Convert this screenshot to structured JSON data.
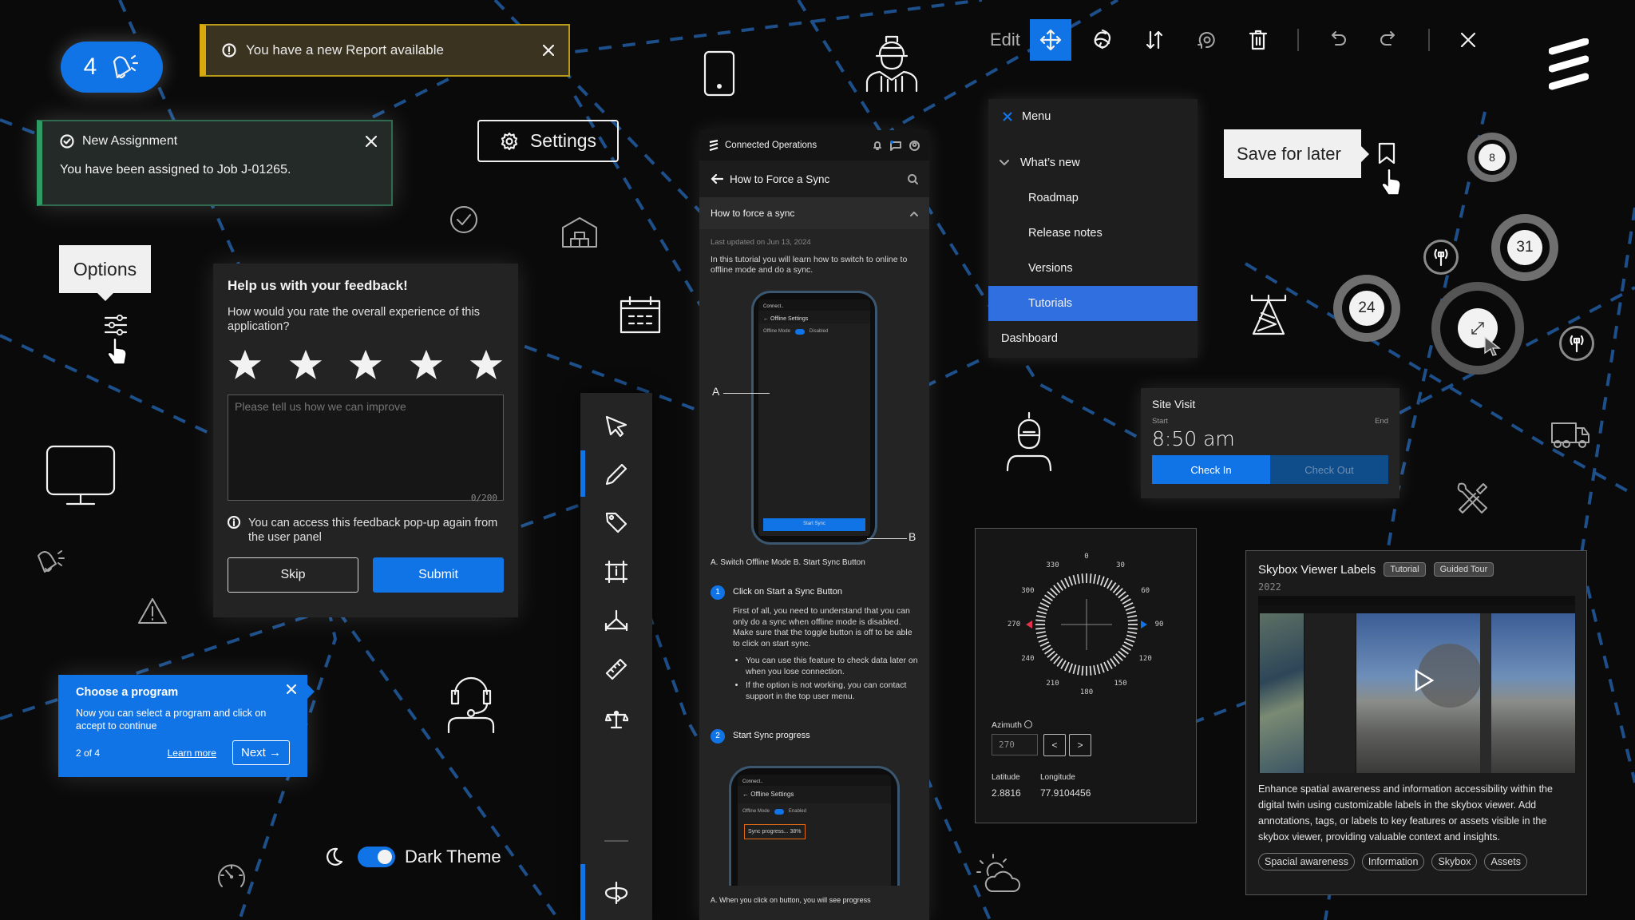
{
  "colors": {
    "accent": "#1174e6",
    "warning": "#d8a80e",
    "success": "#2d9b62",
    "menu_selected": "#2f6fe0",
    "progress_outline": "#e46a16",
    "background": "#0a0a0a"
  },
  "notification_badge": {
    "count": "4",
    "icon": "bell-ringing-icon"
  },
  "report_toast": {
    "icon": "info-circle-icon",
    "message": "You have a new Report available",
    "close_icon": "close-icon"
  },
  "assignment_toast": {
    "icon": "check-circle-icon",
    "title": "New Assignment",
    "message": "You have been assigned to Job J-01265.",
    "close_icon": "close-icon"
  },
  "settings_button": {
    "icon": "gear-icon",
    "label": "Settings"
  },
  "options_tooltip": {
    "label": "Options",
    "icon": "sliders-icon",
    "cursor": "hand-pointer-icon"
  },
  "feedback": {
    "title": "Help us with your feedback!",
    "question": "How would you rate the overall experience of this application?",
    "rating": {
      "value": 5,
      "max": 5
    },
    "textarea_placeholder": "Please tell us how we can improve",
    "textarea_value": "",
    "char_count": "0/200",
    "info_text": "You can access this feedback pop-up again from the user panel",
    "skip_label": "Skip",
    "submit_label": "Submit"
  },
  "coach_mark": {
    "title": "Choose a program",
    "body": "Now you can select a program  and click on accept to continue",
    "step": "2 of 4",
    "learn_more": "Learn more",
    "next_label": "Next →"
  },
  "theme_toggle": {
    "icon": "moon-icon",
    "label": "Dark Theme",
    "enabled": true
  },
  "tool_rail": {
    "items": [
      {
        "name": "select-pointer-icon",
        "active": false
      },
      {
        "name": "pencil-icon",
        "active": true
      },
      {
        "name": "tag-icon",
        "active": false
      },
      {
        "name": "info-frame-icon",
        "active": false
      },
      {
        "name": "measure-angle-icon",
        "active": false
      },
      {
        "name": "ruler-icon",
        "active": false
      },
      {
        "name": "scale-balance-icon",
        "active": false
      },
      {
        "name": "rotate-axis-icon",
        "active": true
      }
    ]
  },
  "tutorial": {
    "app_name": "Connected Operations",
    "page_title": "How to Force a Sync",
    "accordion_title": "How to force a sync",
    "last_updated": "Last updated on Jun 13, 2024",
    "intro": "In this tutorial you will learn how to switch to online to offline mode and do a sync.",
    "phone1": {
      "app_short": "Connect..",
      "screen_title": "← Offline Settings",
      "offline_label": "Offline Mode",
      "toggle_state": "Disabled",
      "button": "Start Sync",
      "callout_a": "A",
      "callout_b": "B"
    },
    "figure_caption": "A. Switch Offline Mode B. Start Sync Button",
    "steps": [
      {
        "num": "1",
        "title": "Click on Start a Sync Button",
        "body": "First of all, you need to understand that you can only do a sync when offline mode is disabled. Make sure that the toggle button is off to be able to click on start sync.",
        "bullets": [
          "You can use this feature to check data later on when you lose connection.",
          "If the option is not working, you can contact support in the top user menu."
        ]
      },
      {
        "num": "2",
        "title": "Start Sync progress",
        "body": "",
        "bullets": []
      }
    ],
    "phone2": {
      "app_short": "Connect..",
      "screen_title": "← Offline Settings",
      "offline_label": "Offline Mode",
      "toggle_state": "Enabled",
      "progress_text": "Sync progress... 38%",
      "progress": 0.38
    },
    "figure2_caption": "A. When you click on button, you will see progress"
  },
  "edit_toolbar": {
    "label": "Edit",
    "tools": [
      "move-icon",
      "rotate-3d-icon",
      "swap-vertical-icon",
      "reset-rotation-icon",
      "trash-icon",
      "undo-icon",
      "redo-icon",
      "close-icon"
    ],
    "active_tool": "move-icon"
  },
  "menu": {
    "close_label": "Menu",
    "group": "What’s new",
    "items": [
      "Roadmap",
      "Release notes",
      "Versions",
      "Tutorials"
    ],
    "selected": "Tutorials",
    "bottom_item": "Dashboard"
  },
  "save_tooltip": {
    "label": "Save for later",
    "icon": "bookmark-icon"
  },
  "map_clusters": [
    "8",
    "31",
    "24"
  ],
  "site_visit": {
    "title": "Site Visit",
    "start_label": "Start",
    "end_label": "End",
    "start_time": "8:50 am",
    "check_in": "Check In",
    "check_out": "Check Out"
  },
  "azimuth_widget": {
    "compass_labels": [
      "0",
      "30",
      "60",
      "90",
      "120",
      "150",
      "180",
      "210",
      "240",
      "270",
      "300",
      "330"
    ],
    "azimuth_label": "Azimuth",
    "azimuth_value": "270",
    "prev_label": "<",
    "next_label": ">",
    "latitude_label": "Latitude",
    "latitude": "2.8816",
    "longitude_label": "Longitude",
    "longitude": "77.9104456"
  },
  "skybox": {
    "title": "Skybox Viewer Labels",
    "badges": [
      "Tutorial",
      "Guided Tour"
    ],
    "year": "2022",
    "description": "Enhance spatial awareness and information accessibility within the digital twin using customizable labels in the skybox viewer. Add annotations, tags, or labels to key features or assets visible in the skybox viewer, providing valuable context and insights.",
    "tags": [
      "Spacial awareness",
      "Information",
      "Skybox",
      "Assets"
    ]
  },
  "decorative_icons": [
    "smartphone-icon",
    "engineer-icon",
    "check-circle-icon",
    "warehouse-icon",
    "calendar-icon",
    "monitor-icon",
    "bell-ringing-icon",
    "warning-triangle-icon",
    "support-agent-icon",
    "speedometer-icon",
    "worker-icon",
    "antenna-tower-icon",
    "truck-icon",
    "tools-icon",
    "weather-partly-cloudy-icon",
    "brand-logo-icon"
  ]
}
